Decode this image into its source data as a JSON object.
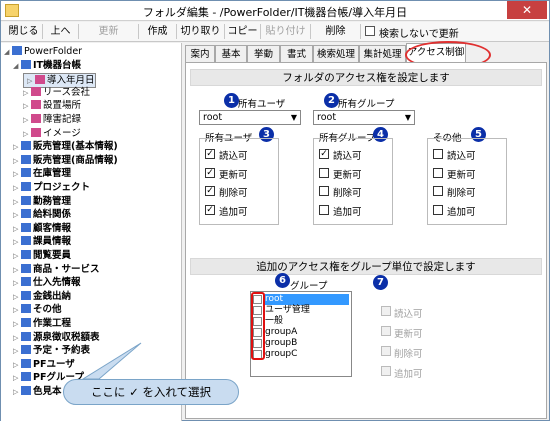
{
  "window": {
    "title": "フォルダ編集 - /PowerFolder/IT機器台帳/導入年月日",
    "close_glyph": "✕"
  },
  "toolbar": {
    "items": [
      {
        "label": "閉じる",
        "enabled": true
      },
      {
        "label": "上へ",
        "enabled": true
      },
      {
        "label": "更新",
        "enabled": false
      },
      {
        "label": "作成",
        "enabled": true
      },
      {
        "label": "切り取り",
        "enabled": true
      },
      {
        "label": "コピー",
        "enabled": true
      },
      {
        "label": "貼り付け",
        "enabled": false
      },
      {
        "label": "削除",
        "enabled": true
      }
    ],
    "checkbox_label": "検索しないで更新"
  },
  "tree": {
    "items": [
      {
        "label": "PowerFolder",
        "level": 0,
        "bold": false,
        "icon": "folder-icon"
      },
      {
        "label": "IT機器台帳",
        "level": 1,
        "bold": true,
        "icon": "folder-icon"
      },
      {
        "label": "導入年月日",
        "level": 2,
        "bold": false,
        "icon": "field-icon",
        "selected": true
      },
      {
        "label": "リース会社",
        "level": 2,
        "bold": false,
        "icon": "field-icon"
      },
      {
        "label": "設置場所",
        "level": 2,
        "bold": false,
        "icon": "field-icon"
      },
      {
        "label": "障害記録",
        "level": 2,
        "bold": false,
        "icon": "field-icon"
      },
      {
        "label": "イメージ",
        "level": 2,
        "bold": false,
        "icon": "field-icon"
      },
      {
        "label": "販売管理(基本情報)",
        "level": 1,
        "bold": true,
        "icon": "folder-icon"
      },
      {
        "label": "販売管理(商品情報)",
        "level": 1,
        "bold": true,
        "icon": "folder-icon"
      },
      {
        "label": "在庫管理",
        "level": 1,
        "bold": true,
        "icon": "folder-icon"
      },
      {
        "label": "プロジェクト",
        "level": 1,
        "bold": true,
        "icon": "folder-icon"
      },
      {
        "label": "勤務管理",
        "level": 1,
        "bold": true,
        "icon": "folder-icon"
      },
      {
        "label": "給料関係",
        "level": 1,
        "bold": true,
        "icon": "folder-icon"
      },
      {
        "label": "顧客情報",
        "level": 1,
        "bold": true,
        "icon": "folder-icon"
      },
      {
        "label": "課員情報",
        "level": 1,
        "bold": true,
        "icon": "folder-icon"
      },
      {
        "label": "閲覧要員",
        "level": 1,
        "bold": true,
        "icon": "folder-icon"
      },
      {
        "label": "商品・サービス",
        "level": 1,
        "bold": true,
        "icon": "folder-icon"
      },
      {
        "label": "仕入先情報",
        "level": 1,
        "bold": true,
        "icon": "folder-icon"
      },
      {
        "label": "金銭出納",
        "level": 1,
        "bold": true,
        "icon": "folder-icon"
      },
      {
        "label": "その他",
        "level": 1,
        "bold": true,
        "icon": "folder-icon"
      },
      {
        "label": "作業工程",
        "level": 1,
        "bold": true,
        "icon": "folder-icon"
      },
      {
        "label": "源泉徴収税額表",
        "level": 1,
        "bold": true,
        "icon": "folder-icon"
      },
      {
        "label": "予定・予約表",
        "level": 1,
        "bold": true,
        "icon": "folder-icon"
      },
      {
        "label": "PFユーザ",
        "level": 1,
        "bold": true,
        "icon": "folder-icon"
      },
      {
        "label": "PFグループ",
        "level": 1,
        "bold": true,
        "icon": "folder-icon"
      },
      {
        "label": "色見本",
        "level": 1,
        "bold": true,
        "icon": "folder-icon"
      }
    ]
  },
  "tabs": [
    "案内",
    "基本",
    "挙動",
    "書式",
    "検索処理",
    "集計処理",
    "アクセス制御"
  ],
  "active_tab": "アクセス制御",
  "access": {
    "header1": "フォルダのアクセス権を設定します",
    "owner_user_label": "所有ユーザ",
    "owner_user_value": "root",
    "owner_group_label": "所有グループ",
    "owner_group_value": "root",
    "groups": [
      {
        "title": "所有ユーザ",
        "badge": "3",
        "items": [
          {
            "label": "読込可",
            "checked": true
          },
          {
            "label": "更新可",
            "checked": true
          },
          {
            "label": "削除可",
            "checked": true
          },
          {
            "label": "追加可",
            "checked": true
          }
        ]
      },
      {
        "title": "所有グループ",
        "badge": "4",
        "items": [
          {
            "label": "読込可",
            "checked": true
          },
          {
            "label": "更新可",
            "checked": false
          },
          {
            "label": "削除可",
            "checked": false
          },
          {
            "label": "追加可",
            "checked": false
          }
        ]
      },
      {
        "title": "その他",
        "badge": "5",
        "items": [
          {
            "label": "読込可",
            "checked": false
          },
          {
            "label": "更新可",
            "checked": false
          },
          {
            "label": "削除可",
            "checked": false
          },
          {
            "label": "追加可",
            "checked": false
          }
        ]
      }
    ],
    "badge1": "1",
    "badge2": "2",
    "check_glyph": "✓",
    "header2": "追加のアクセス権をグループ単位で設定します",
    "group_list_label": "グループ",
    "badge6": "6",
    "badge7": "7",
    "group_list": [
      "root",
      "ユーザ管理",
      "一般",
      "groupA",
      "groupB",
      "groupC"
    ],
    "group_perms": [
      "読込可",
      "更新可",
      "削除可",
      "追加可"
    ]
  },
  "callout": {
    "text": "ここに ✓ を入れて選択"
  },
  "colors": {
    "badge": "#0b2fa8",
    "highlight": "#e01010",
    "callout_fill": "#c9dcf0",
    "selection": "#3399ff"
  }
}
